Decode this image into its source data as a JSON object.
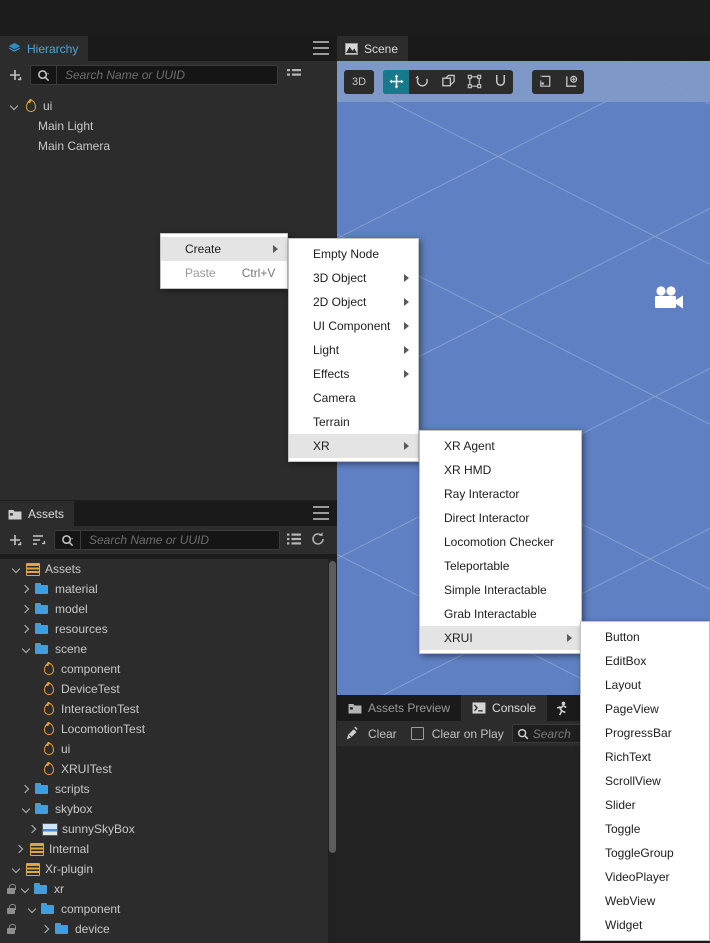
{
  "app": {
    "theme_bg": "#2c2c2c",
    "accent": "#4aa8d8",
    "viewport_color": "#5f80c2"
  },
  "hierarchy": {
    "tab_label": "Hierarchy",
    "tab_icon": "layers-icon",
    "menu_icon": "hamburger-icon",
    "add_icon": "add-node-icon",
    "list_icon": "list-view-icon",
    "search": {
      "placeholder": "Search Name or UUID",
      "value": "",
      "icon": "search-icon"
    },
    "nodes": [
      {
        "label": "ui",
        "icon": "prefab-icon",
        "indent": 0,
        "arrow": "down"
      },
      {
        "label": "Main Light",
        "icon": "none",
        "indent": 1,
        "arrow": "none"
      },
      {
        "label": "Main Camera",
        "icon": "none",
        "indent": 1,
        "arrow": "none"
      }
    ]
  },
  "scene": {
    "tab_label": "Scene",
    "tab_icon": "scene-icon",
    "toolbar": {
      "mode_label": "3D",
      "tools": [
        {
          "name": "move-tool",
          "active": true
        },
        {
          "name": "rotate-tool",
          "active": false
        },
        {
          "name": "scale-tool",
          "active": false
        },
        {
          "name": "rect-transform-tool",
          "active": false
        },
        {
          "name": "magnet-snap-tool",
          "active": false
        }
      ],
      "extras": [
        {
          "name": "pivot-toggle",
          "active": false
        },
        {
          "name": "coordinate-space-toggle",
          "active": false
        }
      ]
    },
    "gizmo": {
      "name": "camera-gizmo-icon"
    }
  },
  "context_menu": {
    "items": [
      {
        "label": "Create",
        "shortcut": "",
        "submenu": true,
        "highlighted": true,
        "disabled": false
      },
      {
        "label": "Paste",
        "shortcut": "Ctrl+V",
        "submenu": false,
        "highlighted": false,
        "disabled": true
      }
    ]
  },
  "create_menu": {
    "items": [
      {
        "label": "Empty Node",
        "submenu": false,
        "highlighted": false
      },
      {
        "label": "3D Object",
        "submenu": true,
        "highlighted": false
      },
      {
        "label": "2D Object",
        "submenu": true,
        "highlighted": false
      },
      {
        "label": "UI Component",
        "submenu": true,
        "highlighted": false
      },
      {
        "label": "Light",
        "submenu": true,
        "highlighted": false
      },
      {
        "label": "Effects",
        "submenu": true,
        "highlighted": false
      },
      {
        "label": "Camera",
        "submenu": false,
        "highlighted": false
      },
      {
        "label": "Terrain",
        "submenu": false,
        "highlighted": false
      },
      {
        "label": "XR",
        "submenu": true,
        "highlighted": true
      }
    ]
  },
  "xr_menu": {
    "items": [
      {
        "label": "XR Agent",
        "submenu": false,
        "highlighted": false
      },
      {
        "label": "XR HMD",
        "submenu": false,
        "highlighted": false
      },
      {
        "label": "Ray Interactor",
        "submenu": false,
        "highlighted": false
      },
      {
        "label": "Direct Interactor",
        "submenu": false,
        "highlighted": false
      },
      {
        "label": "Locomotion Checker",
        "submenu": false,
        "highlighted": false
      },
      {
        "label": "Teleportable",
        "submenu": false,
        "highlighted": false
      },
      {
        "label": "Simple Interactable",
        "submenu": false,
        "highlighted": false
      },
      {
        "label": "Grab Interactable",
        "submenu": false,
        "highlighted": false
      },
      {
        "label": "XRUI",
        "submenu": true,
        "highlighted": true
      }
    ]
  },
  "xrui_menu": {
    "items": [
      {
        "label": "Button"
      },
      {
        "label": "EditBox"
      },
      {
        "label": "Layout"
      },
      {
        "label": "PageView"
      },
      {
        "label": "ProgressBar"
      },
      {
        "label": "RichText"
      },
      {
        "label": "ScrollView"
      },
      {
        "label": "Slider"
      },
      {
        "label": "Toggle"
      },
      {
        "label": "ToggleGroup"
      },
      {
        "label": "VideoPlayer"
      },
      {
        "label": "WebView"
      },
      {
        "label": "Widget"
      }
    ]
  },
  "assets": {
    "tab_label": "Assets",
    "tab_icon": "folder-icon",
    "menu_icon": "hamburger-icon",
    "add_icon": "add-asset-icon",
    "sort_icon": "sort-icon",
    "list_icon": "list-view-icon",
    "refresh_icon": "refresh-icon",
    "search": {
      "placeholder": "Search Name or UUID",
      "value": "",
      "icon": "search-icon"
    },
    "tree": [
      {
        "label": "Assets",
        "icon": "db-icon",
        "indent": 0,
        "arrow": "down",
        "lock": false
      },
      {
        "label": "material",
        "icon": "folder-icon",
        "indent": 1,
        "arrow": "right",
        "lock": false
      },
      {
        "label": "model",
        "icon": "folder-icon",
        "indent": 1,
        "arrow": "right",
        "lock": false
      },
      {
        "label": "resources",
        "icon": "folder-icon",
        "indent": 1,
        "arrow": "right",
        "lock": false
      },
      {
        "label": "scene",
        "icon": "folder-icon",
        "indent": 1,
        "arrow": "down",
        "lock": false
      },
      {
        "label": "component",
        "icon": "prefab-icon",
        "indent": 2,
        "arrow": "none",
        "lock": false
      },
      {
        "label": "DeviceTest",
        "icon": "prefab-icon",
        "indent": 2,
        "arrow": "none",
        "lock": false
      },
      {
        "label": "InteractionTest",
        "icon": "prefab-icon",
        "indent": 2,
        "arrow": "none",
        "lock": false
      },
      {
        "label": "LocomotionTest",
        "icon": "prefab-icon",
        "indent": 2,
        "arrow": "none",
        "lock": false
      },
      {
        "label": "ui",
        "icon": "prefab-icon",
        "indent": 2,
        "arrow": "none",
        "lock": false
      },
      {
        "label": "XRUITest",
        "icon": "prefab-icon",
        "indent": 2,
        "arrow": "none",
        "lock": false
      },
      {
        "label": "scripts",
        "icon": "folder-icon",
        "indent": 1,
        "arrow": "right",
        "lock": false
      },
      {
        "label": "skybox",
        "icon": "folder-icon",
        "indent": 1,
        "arrow": "down",
        "lock": false
      },
      {
        "label": "sunnySkyBox",
        "icon": "skybox-icon",
        "indent": 2,
        "arrow": "right",
        "lock": false
      },
      {
        "label": "Internal",
        "icon": "db-icon",
        "indent": 0,
        "arrow": "right",
        "lock": false
      },
      {
        "label": "Xr-plugin",
        "icon": "db-icon",
        "indent": 0,
        "arrow": "down",
        "lock": false
      },
      {
        "label": "xr",
        "icon": "folder-icon",
        "indent": 0,
        "arrow": "down",
        "lock": true
      },
      {
        "label": "component",
        "icon": "folder-icon",
        "indent": 1,
        "arrow": "down",
        "lock": true
      },
      {
        "label": "device",
        "icon": "folder-icon",
        "indent": 2,
        "arrow": "right",
        "lock": true
      }
    ]
  },
  "console": {
    "tabs": [
      {
        "label": "Assets Preview",
        "icon": "preview-icon",
        "active": false
      },
      {
        "label": "Console",
        "icon": "terminal-icon",
        "active": true
      },
      {
        "label": "",
        "icon": "animation-icon",
        "active": false
      }
    ],
    "clear_label": "Clear",
    "clear_icon": "broom-icon",
    "clear_on_play_label": "Clear on Play",
    "clear_on_play_checked": false,
    "search": {
      "placeholder": "Search",
      "value": "",
      "icon": "search-icon"
    }
  }
}
